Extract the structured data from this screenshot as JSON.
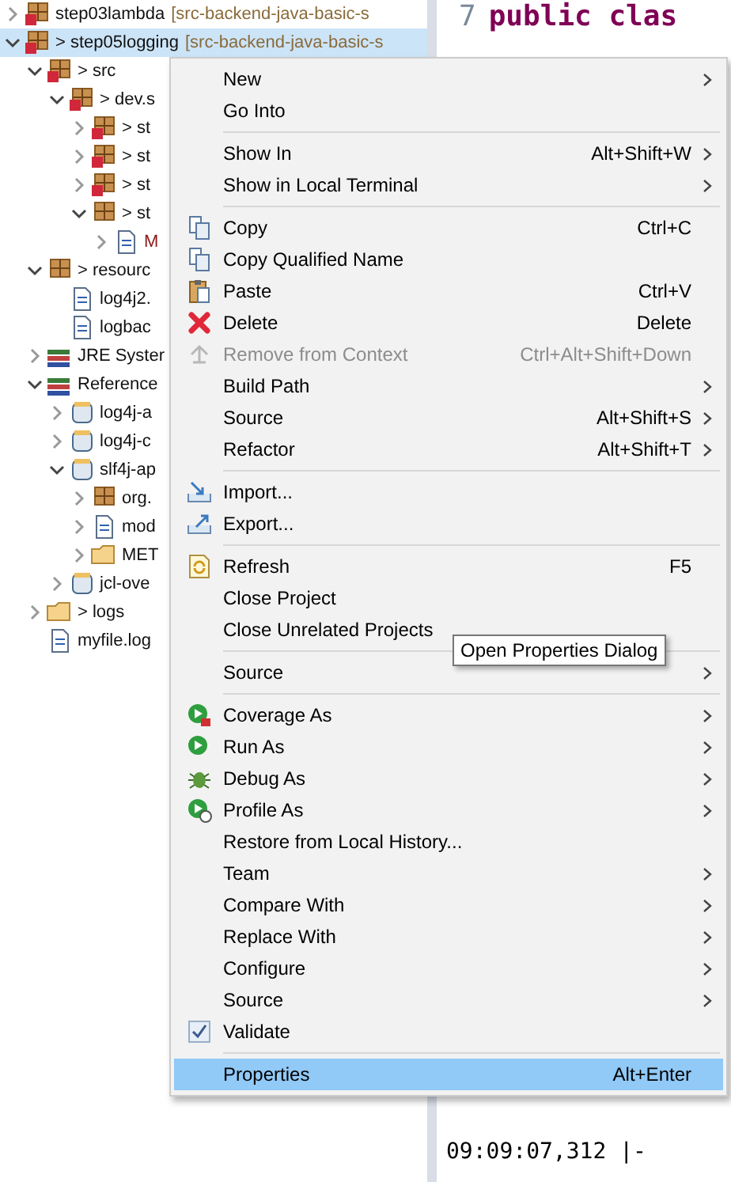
{
  "tree": [
    {
      "label": "step03lambda",
      "repo": "[src-backend-java-basic-s",
      "kind": "project",
      "expanded": false,
      "error": true,
      "selected": false
    },
    {
      "label": "> step05logging",
      "repo": "[src-backend-java-basic-s",
      "kind": "project",
      "expanded": true,
      "error": true,
      "selected": true,
      "children": [
        {
          "label": "> src",
          "kind": "source-folder",
          "expanded": true,
          "error": true,
          "selected": false,
          "children": [
            {
              "label": "> dev.s",
              "kind": "package",
              "expanded": true,
              "error": true,
              "selected": false,
              "children": [
                {
                  "label": "> st",
                  "kind": "package",
                  "expanded": false,
                  "error": true,
                  "selected": false
                },
                {
                  "label": "> st",
                  "kind": "package",
                  "expanded": false,
                  "error": true,
                  "selected": false
                },
                {
                  "label": "> st",
                  "kind": "package",
                  "expanded": false,
                  "error": true,
                  "selected": false
                },
                {
                  "label": "> st",
                  "kind": "package",
                  "expanded": true,
                  "error": false,
                  "selected": false,
                  "children": [
                    {
                      "label": "M",
                      "kind": "java",
                      "expanded": false,
                      "error": false,
                      "selected": false
                    }
                  ]
                }
              ]
            }
          ]
        },
        {
          "label": "> resourc",
          "kind": "source-folder",
          "expanded": true,
          "error": false,
          "selected": false,
          "children": [
            {
              "label": "log4j2.",
              "kind": "xml",
              "error": false,
              "selected": false
            },
            {
              "label": "logbac",
              "kind": "xml",
              "error": false,
              "selected": false
            }
          ]
        },
        {
          "label": "JRE Syster",
          "kind": "library",
          "expanded": false,
          "error": false,
          "selected": false
        },
        {
          "label": "Reference",
          "kind": "library",
          "expanded": true,
          "error": false,
          "selected": false,
          "children": [
            {
              "label": "log4j-a",
              "kind": "jar",
              "expanded": false,
              "error": false,
              "selected": false
            },
            {
              "label": "log4j-c",
              "kind": "jar",
              "expanded": false,
              "error": false,
              "selected": false
            },
            {
              "label": "slf4j-ap",
              "kind": "jar",
              "expanded": true,
              "error": false,
              "selected": false,
              "children": [
                {
                  "label": "org.",
                  "kind": "package",
                  "expanded": false,
                  "error": false,
                  "selected": false
                },
                {
                  "label": "mod",
                  "kind": "class-file",
                  "expanded": false,
                  "error": false,
                  "selected": false
                },
                {
                  "label": "MET",
                  "kind": "folder",
                  "expanded": false,
                  "error": false,
                  "selected": false
                }
              ]
            },
            {
              "label": "jcl-ove",
              "kind": "jar",
              "expanded": false,
              "error": false,
              "selected": false
            }
          ]
        },
        {
          "label": "> logs",
          "kind": "folder",
          "expanded": false,
          "error": false,
          "selected": false
        },
        {
          "label": "myfile.log",
          "kind": "file",
          "error": false,
          "selected": false
        }
      ]
    }
  ],
  "editor": {
    "line_number": "7",
    "code": "public clas"
  },
  "console": {
    "text": "09:09:07,312 |-"
  },
  "menu": [
    {
      "kind": "plain",
      "label": "New",
      "submenu": true,
      "disabled": false,
      "selected": false
    },
    {
      "kind": "plain",
      "label": "Go Into",
      "submenu": false,
      "disabled": false,
      "selected": false
    },
    {
      "kind": "separator"
    },
    {
      "kind": "plain",
      "label": "Show In",
      "shortcut": "Alt+Shift+W",
      "submenu": true,
      "disabled": false,
      "selected": false
    },
    {
      "kind": "plain",
      "label": "Show in Local Terminal",
      "submenu": true,
      "disabled": false,
      "selected": false
    },
    {
      "kind": "separator"
    },
    {
      "kind": "copy",
      "label": "Copy",
      "shortcut": "Ctrl+C",
      "submenu": false,
      "disabled": false,
      "selected": false
    },
    {
      "kind": "copy-name",
      "label": "Copy Qualified Name",
      "submenu": false,
      "disabled": false,
      "selected": false
    },
    {
      "kind": "paste",
      "label": "Paste",
      "shortcut": "Ctrl+V",
      "submenu": false,
      "disabled": false,
      "selected": false
    },
    {
      "kind": "delete",
      "label": "Delete",
      "shortcut": "Delete",
      "submenu": false,
      "disabled": false,
      "selected": false
    },
    {
      "kind": "remove",
      "label": "Remove from Context",
      "shortcut": "Ctrl+Alt+Shift+Down",
      "submenu": false,
      "disabled": true,
      "selected": false
    },
    {
      "kind": "plain",
      "label": "Build Path",
      "submenu": true,
      "disabled": false,
      "selected": false
    },
    {
      "kind": "plain",
      "label": "Source",
      "shortcut": "Alt+Shift+S",
      "submenu": true,
      "disabled": false,
      "selected": false
    },
    {
      "kind": "plain",
      "label": "Refactor",
      "shortcut": "Alt+Shift+T",
      "submenu": true,
      "disabled": false,
      "selected": false
    },
    {
      "kind": "separator"
    },
    {
      "kind": "import",
      "label": "Import...",
      "submenu": false,
      "disabled": false,
      "selected": false
    },
    {
      "kind": "export",
      "label": "Export...",
      "submenu": false,
      "disabled": false,
      "selected": false
    },
    {
      "kind": "separator"
    },
    {
      "kind": "refresh",
      "label": "Refresh",
      "shortcut": "F5",
      "submenu": false,
      "disabled": false,
      "selected": false
    },
    {
      "kind": "plain",
      "label": "Close Project",
      "submenu": false,
      "disabled": false,
      "selected": false
    },
    {
      "kind": "plain",
      "label": "Close Unrelated Projects",
      "submenu": false,
      "disabled": false,
      "selected": false
    },
    {
      "kind": "separator"
    },
    {
      "kind": "plain",
      "label": "Source",
      "submenu": true,
      "disabled": false,
      "selected": false
    },
    {
      "kind": "separator"
    },
    {
      "kind": "coverage",
      "label": "Coverage As",
      "submenu": true,
      "disabled": false,
      "selected": false
    },
    {
      "kind": "run",
      "label": "Run As",
      "submenu": true,
      "disabled": false,
      "selected": false
    },
    {
      "kind": "debug",
      "label": "Debug As",
      "submenu": true,
      "disabled": false,
      "selected": false
    },
    {
      "kind": "profile",
      "label": "Profile As",
      "submenu": true,
      "disabled": false,
      "selected": false
    },
    {
      "kind": "plain",
      "label": "Restore from Local History...",
      "submenu": false,
      "disabled": false,
      "selected": false
    },
    {
      "kind": "plain",
      "label": "Team",
      "submenu": true,
      "disabled": false,
      "selected": false
    },
    {
      "kind": "plain",
      "label": "Compare With",
      "submenu": true,
      "disabled": false,
      "selected": false
    },
    {
      "kind": "plain",
      "label": "Replace With",
      "submenu": true,
      "disabled": false,
      "selected": false
    },
    {
      "kind": "plain",
      "label": "Configure",
      "submenu": true,
      "disabled": false,
      "selected": false
    },
    {
      "kind": "plain",
      "label": "Source",
      "submenu": true,
      "disabled": false,
      "selected": false
    },
    {
      "kind": "check",
      "label": "Validate",
      "checked": true,
      "submenu": false,
      "disabled": false,
      "selected": false
    },
    {
      "kind": "separator"
    },
    {
      "kind": "plain",
      "label": "Properties",
      "shortcut": "Alt+Enter",
      "submenu": false,
      "disabled": false,
      "selected": true
    }
  ],
  "tooltip": "Open Properties Dialog"
}
